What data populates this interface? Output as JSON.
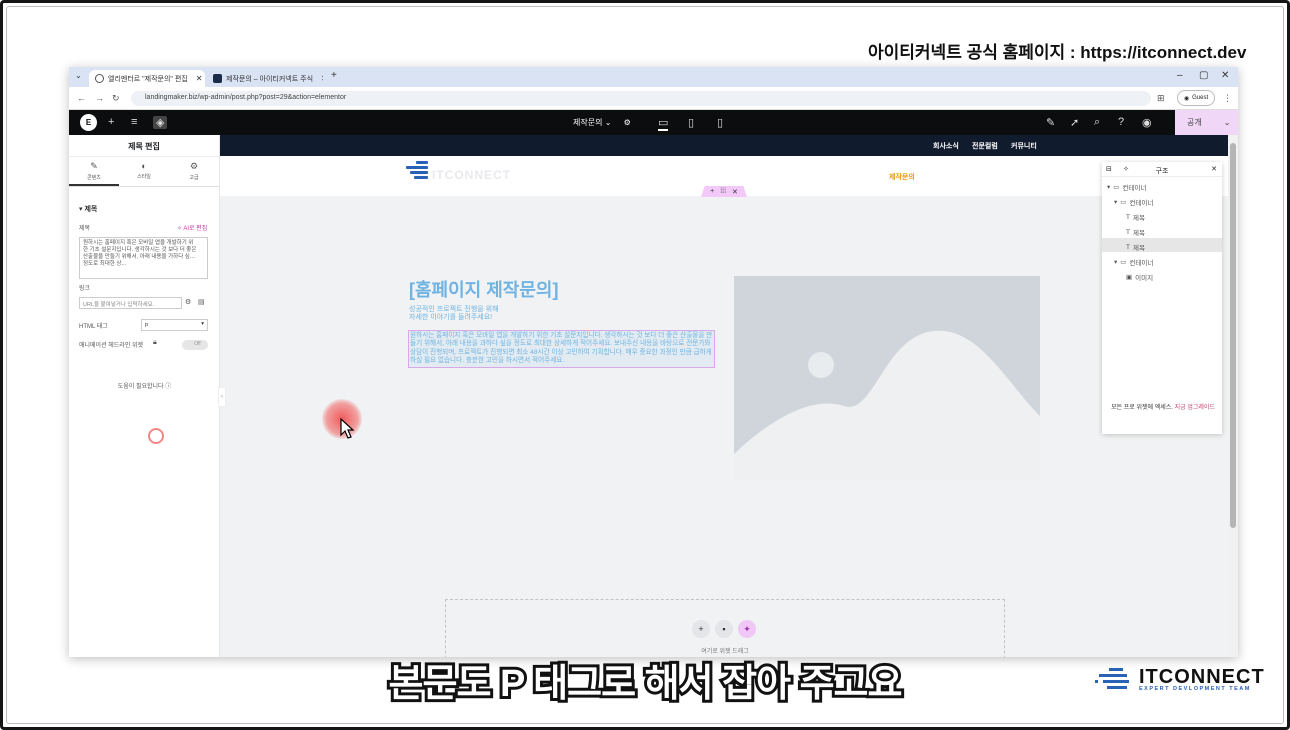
{
  "top_banner": "아이티커넥트 공식 홈페이지 : https://itconnect.dev",
  "browser": {
    "tabs": [
      {
        "label": "엘리멘터르 \"제작문의\" 편집"
      },
      {
        "label": "제작문의 – 아이티커넥트 주식"
      }
    ],
    "new_tab": "+",
    "url": "landingmaker.biz/wp-admin/post.php?post=29&action=elementor",
    "guest_label": "Guest"
  },
  "editor_bar": {
    "page_select": "제작문의",
    "publish": "공개"
  },
  "panel": {
    "title": "제목 편집",
    "tabs": [
      "콘텐츠",
      "스타일",
      "고급"
    ],
    "section": "제목",
    "title_label": "제목",
    "ai_edit": "AI로 편집",
    "textarea": "원하시는 홈페이지 혹은 모바일 앱을 개발하기 위한 기초 설문지입니다. 생각하시는 것 보다 더 좋은 산출물을 만들기 위해서, 아래 내용을 가하다 싶.... 정도로 최대한 상...",
    "link_label": "링크",
    "link_placeholder": "URL을 붙여넣거나 입력하세요.",
    "html_tag_label": "HTML 태그",
    "html_tag_value": "p",
    "anim_label": "애니메이션 헤드라인 위젯",
    "toggle": "Off",
    "help": "도움이 필요합니다"
  },
  "site": {
    "menu": [
      "회사소식",
      "전문컬럼",
      "커뮤니티"
    ],
    "logo_text": "ITCONNECT",
    "jakmun": "제작문의",
    "heading": "[홈페이지 제작문의]",
    "subheading": [
      "성공적인 프로젝트 진행을 위해",
      "자세한 이야기를 들려주세요!"
    ],
    "body": "원하시는 홈페이지 혹은 모바일 앱을 개발하기 위한 기초 설문지입니다. 생각하시는 것 보다 더 좋은 산출물을 만들기 위해서, 아래 내용을 과하다 싶을 정도로 최대한 상세하게 적어주세요. 보내주신 내용을 바탕으로 전문가와 상담이 진행되며, 프로젝트가 진행되면 최소 48시간 이상 고민하여 기획합니다. 매우 중요한 과정인 만큼 급하게 하실 필요 없습니다. 충분한 고민을 하시면서 적어주세요.",
    "drop_text": "여기로 위젯 드래그"
  },
  "navigator": {
    "title": "구조",
    "items": [
      {
        "label": "컨테이너",
        "level": 0,
        "type": "container"
      },
      {
        "label": "컨테이너",
        "level": 1,
        "type": "container"
      },
      {
        "label": "제목",
        "level": 2,
        "type": "heading"
      },
      {
        "label": "제목",
        "level": 2,
        "type": "heading"
      },
      {
        "label": "제목",
        "level": 2,
        "type": "heading",
        "selected": true
      },
      {
        "label": "컨테이너",
        "level": 1,
        "type": "container"
      },
      {
        "label": "이미지",
        "level": 2,
        "type": "image"
      }
    ],
    "footer_text": "모든 프로 위젯에 엑세스.",
    "footer_link": "지금 업그레이드"
  },
  "caption": "본문도 P 태그로 해서 잡아 주고요",
  "brand": {
    "name": "ITCONNECT",
    "tagline": "EXPERT DEVLOPMENT TEAM"
  },
  "colors": {
    "accent": "#6fb3e3",
    "publish_bg": "#f0d6f7",
    "site_header": "#101b2d",
    "menu_highlight": "#e89a17"
  }
}
